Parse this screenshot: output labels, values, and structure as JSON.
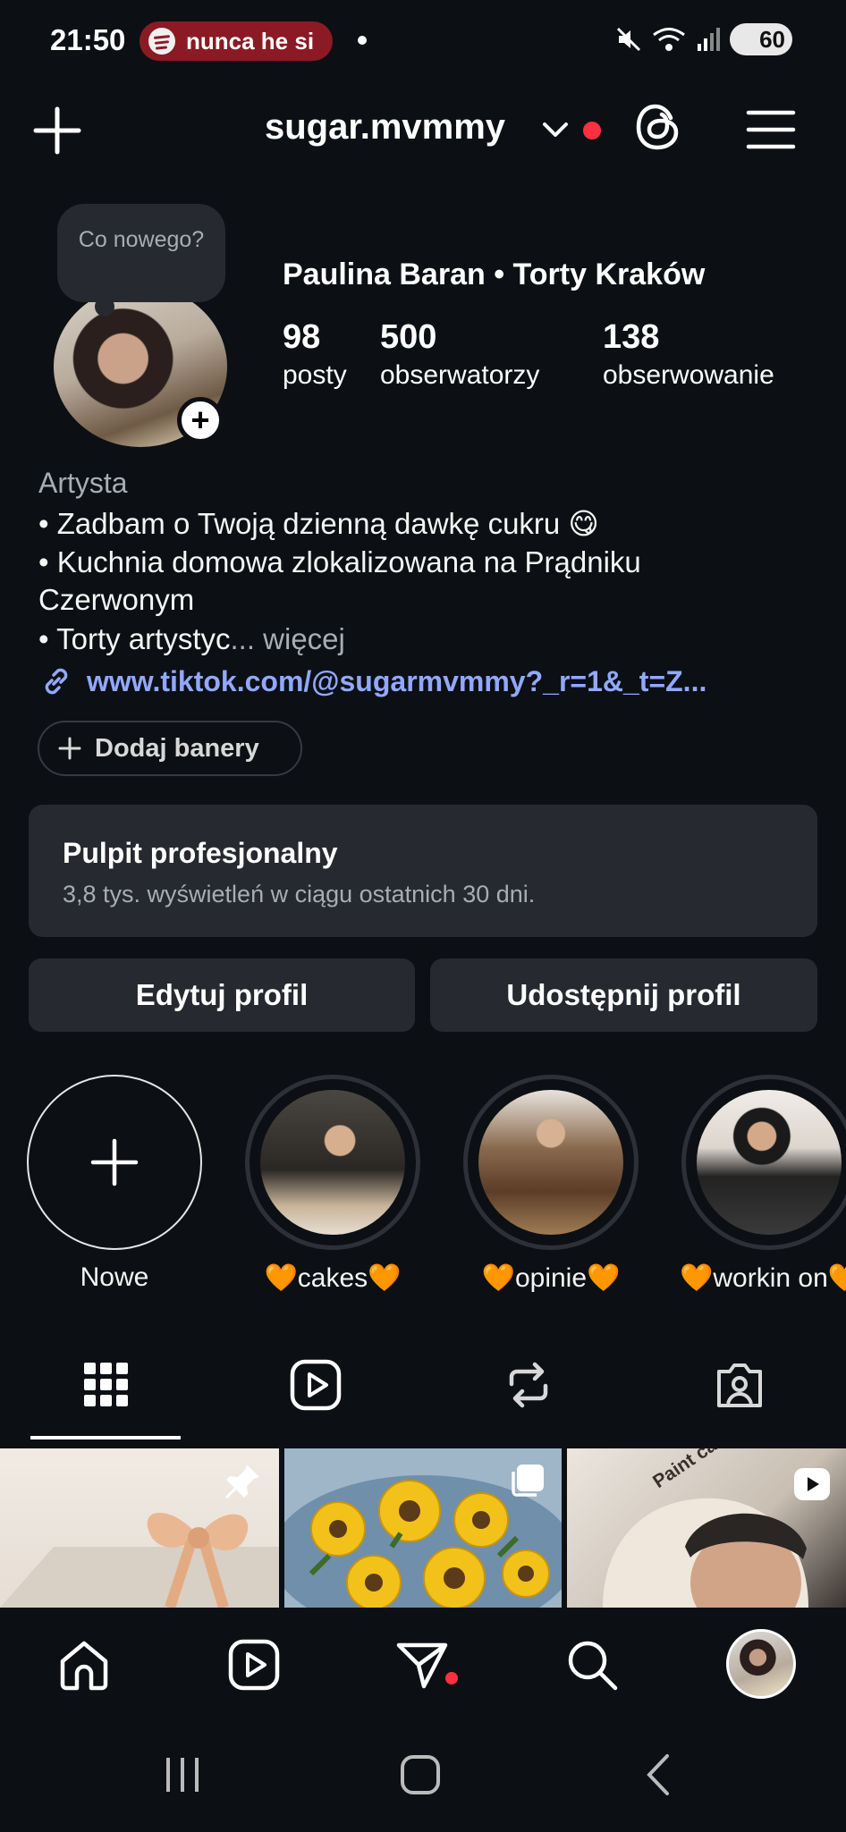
{
  "status_bar": {
    "time": "21:50",
    "media_text": "nunca he si",
    "battery": "60"
  },
  "header": {
    "username": "sugar.mvmmy"
  },
  "profile": {
    "note": "Co nowego?",
    "display_name": "Paulina Baran • Torty Kraków",
    "stats": [
      {
        "value": "98",
        "label": "posty"
      },
      {
        "value": "500",
        "label": "obserwatorzy"
      },
      {
        "value": "138",
        "label": "obserwowanie"
      }
    ],
    "category": "Artysta",
    "bio": [
      "• Zadbam o Twoją dzienną dawkę cukru 😋",
      "• Kuchnia domowa zlokalizowana na Prądniku",
      "Czerwonym",
      "• Torty artystyc"
    ],
    "more": "... więcej",
    "link": "www.tiktok.com/@sugarmvmmy?_r=1&_t=Z...",
    "add_banners": "Dodaj banery"
  },
  "dashboard": {
    "title": "Pulpit profesjonalny",
    "subtitle": "3,8 tys. wyświetleń w ciągu ostatnich 30 dni."
  },
  "actions": {
    "edit": "Edytuj profil",
    "share": "Udostępnij profil"
  },
  "highlights": [
    {
      "label": "Nowe"
    },
    {
      "label": "🧡cakes🧡"
    },
    {
      "label": "🧡opinie🧡"
    },
    {
      "label": "🧡workin on🧡"
    }
  ],
  "grid": {
    "cell3_caption": "Paint cake with me"
  },
  "icons": [
    "plus-icon",
    "chevron-down-icon",
    "threads-icon",
    "menu-icon",
    "grid-icon",
    "reels-icon",
    "repost-icon",
    "tagged-icon",
    "home-icon",
    "send-icon",
    "search-icon",
    "pin-icon",
    "carousel-icon"
  ],
  "colors": {
    "background": "#0c1014",
    "card": "#262a30",
    "link": "#92a8ff",
    "notification": "#ff3040",
    "spotify_pill": "#8b1a24"
  }
}
